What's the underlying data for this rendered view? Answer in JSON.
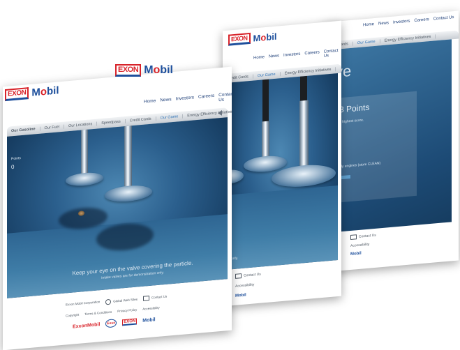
{
  "brand": {
    "exxon": "EXON",
    "mobil": "Mobil",
    "mobil_o": "o"
  },
  "nav": [
    "Home",
    "News",
    "Investors",
    "Careers",
    "Contact Us"
  ],
  "subnav": {
    "section": "Our Gasoline",
    "items": [
      "Our Fuel",
      "Our Locations",
      "Speedpass",
      "Credit Cards",
      "Our Game",
      "Energy Efficiency Initiatives"
    ],
    "active_index": 4
  },
  "game": {
    "points_label": "Points",
    "points_value": "0",
    "instruction": "Keep your eye on the valve covering the particle.",
    "disclaimer": "Intake valves are for demonstration only.",
    "disclaimer_partial": "only."
  },
  "back_game": {
    "title_partial": "ve",
    "score_heading": "3 Points",
    "score_sub": "e highest score.",
    "engine_text": "nly engines (store CLEAN)"
  },
  "footer": {
    "links_row1": [
      "Exxon Mobil Corporation",
      "Global Web Sites",
      "Contact Us"
    ],
    "links_row2": [
      "Copyright",
      "Terms & Conditions",
      "Privacy Policy",
      "Accessibility"
    ],
    "brands": [
      "ExxonMobil",
      "Esso",
      "EXON",
      "Mobil"
    ]
  },
  "colors": {
    "exxon_red": "#d8232a",
    "mobil_blue": "#1d4f9c",
    "stage_blue": "#2b5f8d",
    "active_tab": "#2f73b8"
  }
}
